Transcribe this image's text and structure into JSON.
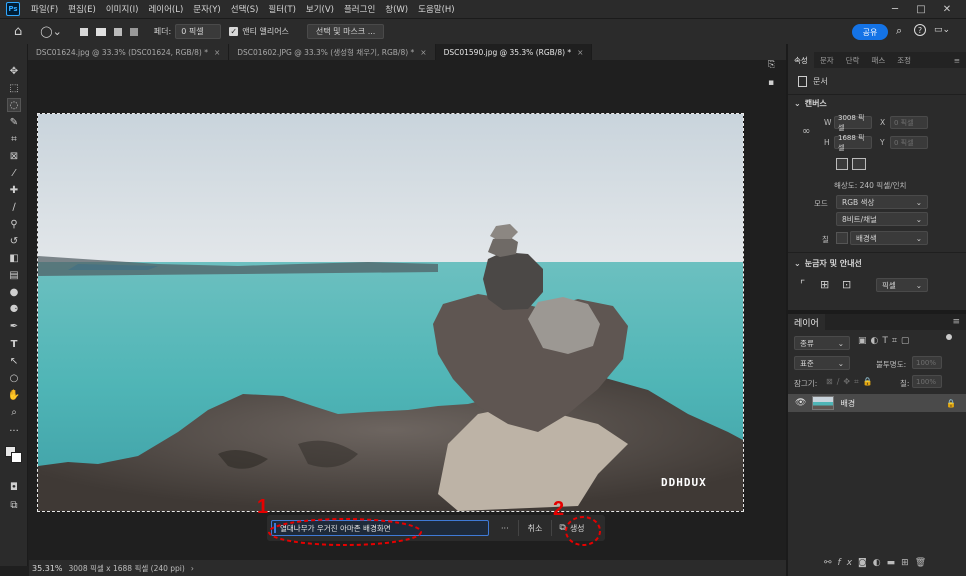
{
  "app": {
    "logo": "Ps"
  },
  "menu": [
    "파일(F)",
    "편집(E)",
    "이미지(I)",
    "레이어(L)",
    "문자(Y)",
    "선택(S)",
    "필터(T)",
    "보기(V)",
    "플러그인",
    "창(W)",
    "도움말(H)"
  ],
  "options": {
    "feather_label": "페더:",
    "feather_value": "0 픽셀",
    "antialias_label": "앤티 앨리어스",
    "select_mask_button": "선택 및 마스크 ...",
    "share_button": "공유"
  },
  "tabs": [
    {
      "label": "DSC01624.jpg @ 33.3% (DSC01624, RGB/8) *",
      "close": "×"
    },
    {
      "label": "DSC01602.JPG @ 33.3% (생성형 채우기, RGB/8) *",
      "close": "×"
    },
    {
      "label": "DSC01590.jpg @ 35.3% (RGB/8) *",
      "close": "×",
      "active": true
    }
  ],
  "canvas": {
    "watermark": "DDHDUX",
    "prompt_text": "열대나무가 우거진 아마존 배경화면",
    "more_button": "···",
    "cancel_button": "취소",
    "generate_button": "생성",
    "annotation_1": "1",
    "annotation_2": "2"
  },
  "status": {
    "zoom": "35.31%",
    "doc_info": "3008 픽셀 x 1688 픽셀 (240 ppi)",
    "arrow": "›"
  },
  "properties": {
    "tabs": [
      "속성",
      "문자",
      "단락",
      "패스",
      "조정"
    ],
    "doc_label": "문서",
    "canvas_section": "캔버스",
    "w_label": "W",
    "w_value": "3008 픽셀",
    "h_label": "H",
    "h_value": "1688 픽셀",
    "x_label": "X",
    "x_value": "0 픽셀",
    "y_label": "Y",
    "y_value": "0 픽셀",
    "resolution": "해상도: 240 픽셀/인치",
    "mode_label": "모드",
    "mode_value": "RGB 색상",
    "depth_value": "8비트/채널",
    "fill_label": "칠",
    "fill_value": "배경색",
    "guides_section": "눈금자 및 안내선",
    "units_value": "픽셀"
  },
  "layers": {
    "tab": "레이어",
    "filter_value": "종류",
    "blend_value": "표준",
    "opacity_label": "불투명도:",
    "opacity_value": "100%",
    "lock_label": "잠그기:",
    "fill_label": "칠:",
    "fill_value": "100%",
    "layer_name": "배경"
  }
}
